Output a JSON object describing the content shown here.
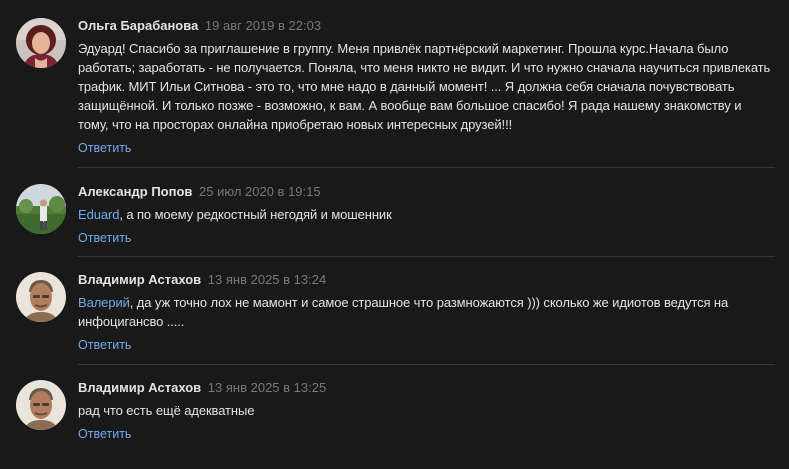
{
  "comments": [
    {
      "author": "Ольга Барабанова",
      "date": "19 авг 2019 в 22:03",
      "mention": "",
      "text": "Эдуард! Спасибо за приглашение в группу. Меня привлёк партнёрский маркетинг. Прошла курс.Начала было работать; заработать - не получается. Поняла, что меня никто не видит. И что нужно сначала научиться привлекать трафик. МИТ Ильи Ситнова - это то, что мне надо в данный момент! ... Я должна себя сначала почувствовать защищённой. И только позже - возможно, к вам. А вообще вам большое спасибо! Я рада нашему знакомству и тому, что на просторах онлайна приобретаю новых интересных друзей!!!",
      "reply": "Ответить"
    },
    {
      "author": "Александр Попов",
      "date": "25 июл 2020 в 19:15",
      "mention": "Eduard",
      "text": ", а по моему редкостный негодяй и мошенник",
      "reply": "Ответить"
    },
    {
      "author": "Владимир Астахов",
      "date": "13 янв 2025 в 13:24",
      "mention": "Валерий",
      "text": ", да уж точно лох не мамонт и самое страшное что размножаются ))) сколько же идиотов ведутся на инфоцигансво .....",
      "reply": "Ответить"
    },
    {
      "author": "Владимир Астахов",
      "date": "13 янв 2025 в 13:25",
      "mention": "",
      "text": "рад что есть ещё адекватные",
      "reply": "Ответить"
    }
  ],
  "colors": {
    "background": "#191919",
    "text": "#e1e3e6",
    "secondary": "#76787a",
    "link": "#71aaeb",
    "divider": "#363738"
  }
}
